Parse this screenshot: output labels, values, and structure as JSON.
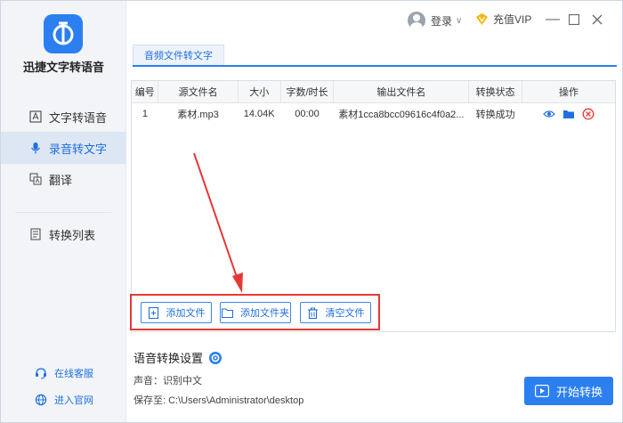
{
  "app": {
    "name": "迅捷文字转语音"
  },
  "sidebar": {
    "items": [
      {
        "label": "文字转语音",
        "icon": "text-to-speech-icon",
        "active": false
      },
      {
        "label": "录音转文字",
        "icon": "microphone-icon",
        "active": true
      },
      {
        "label": "翻译",
        "icon": "translate-icon",
        "active": false
      },
      {
        "label": "转换列表",
        "icon": "list-icon",
        "active": false
      }
    ],
    "footer": [
      {
        "label": "在线客服",
        "icon": "headset-icon"
      },
      {
        "label": "进入官网",
        "icon": "globe-icon"
      }
    ]
  },
  "header": {
    "login_label": "登录",
    "vip_label": "充值VIP"
  },
  "tab": {
    "label": "音频文件转文字"
  },
  "table": {
    "columns": [
      "编号",
      "源文件名",
      "大小",
      "字数/时长",
      "输出文件名",
      "转换状态",
      "操作"
    ],
    "rows": [
      {
        "index": "1",
        "source": "素材.mp3",
        "size": "14.04K",
        "duration": "00:00",
        "output": "素材1cca8bcc09616c4f0a2...",
        "status": "转换成功"
      }
    ]
  },
  "actions": {
    "add_file": "添加文件",
    "add_folder": "添加文件夹",
    "clear": "清空文件"
  },
  "settings": {
    "title": "语音转换设置",
    "voice": "声音：识别中文",
    "save_path": "保存至: C:\\Users\\Administrator\\desktop"
  },
  "start_button": "开始转换",
  "colors": {
    "accent": "#2b7ff0",
    "highlight": "#e53935"
  }
}
